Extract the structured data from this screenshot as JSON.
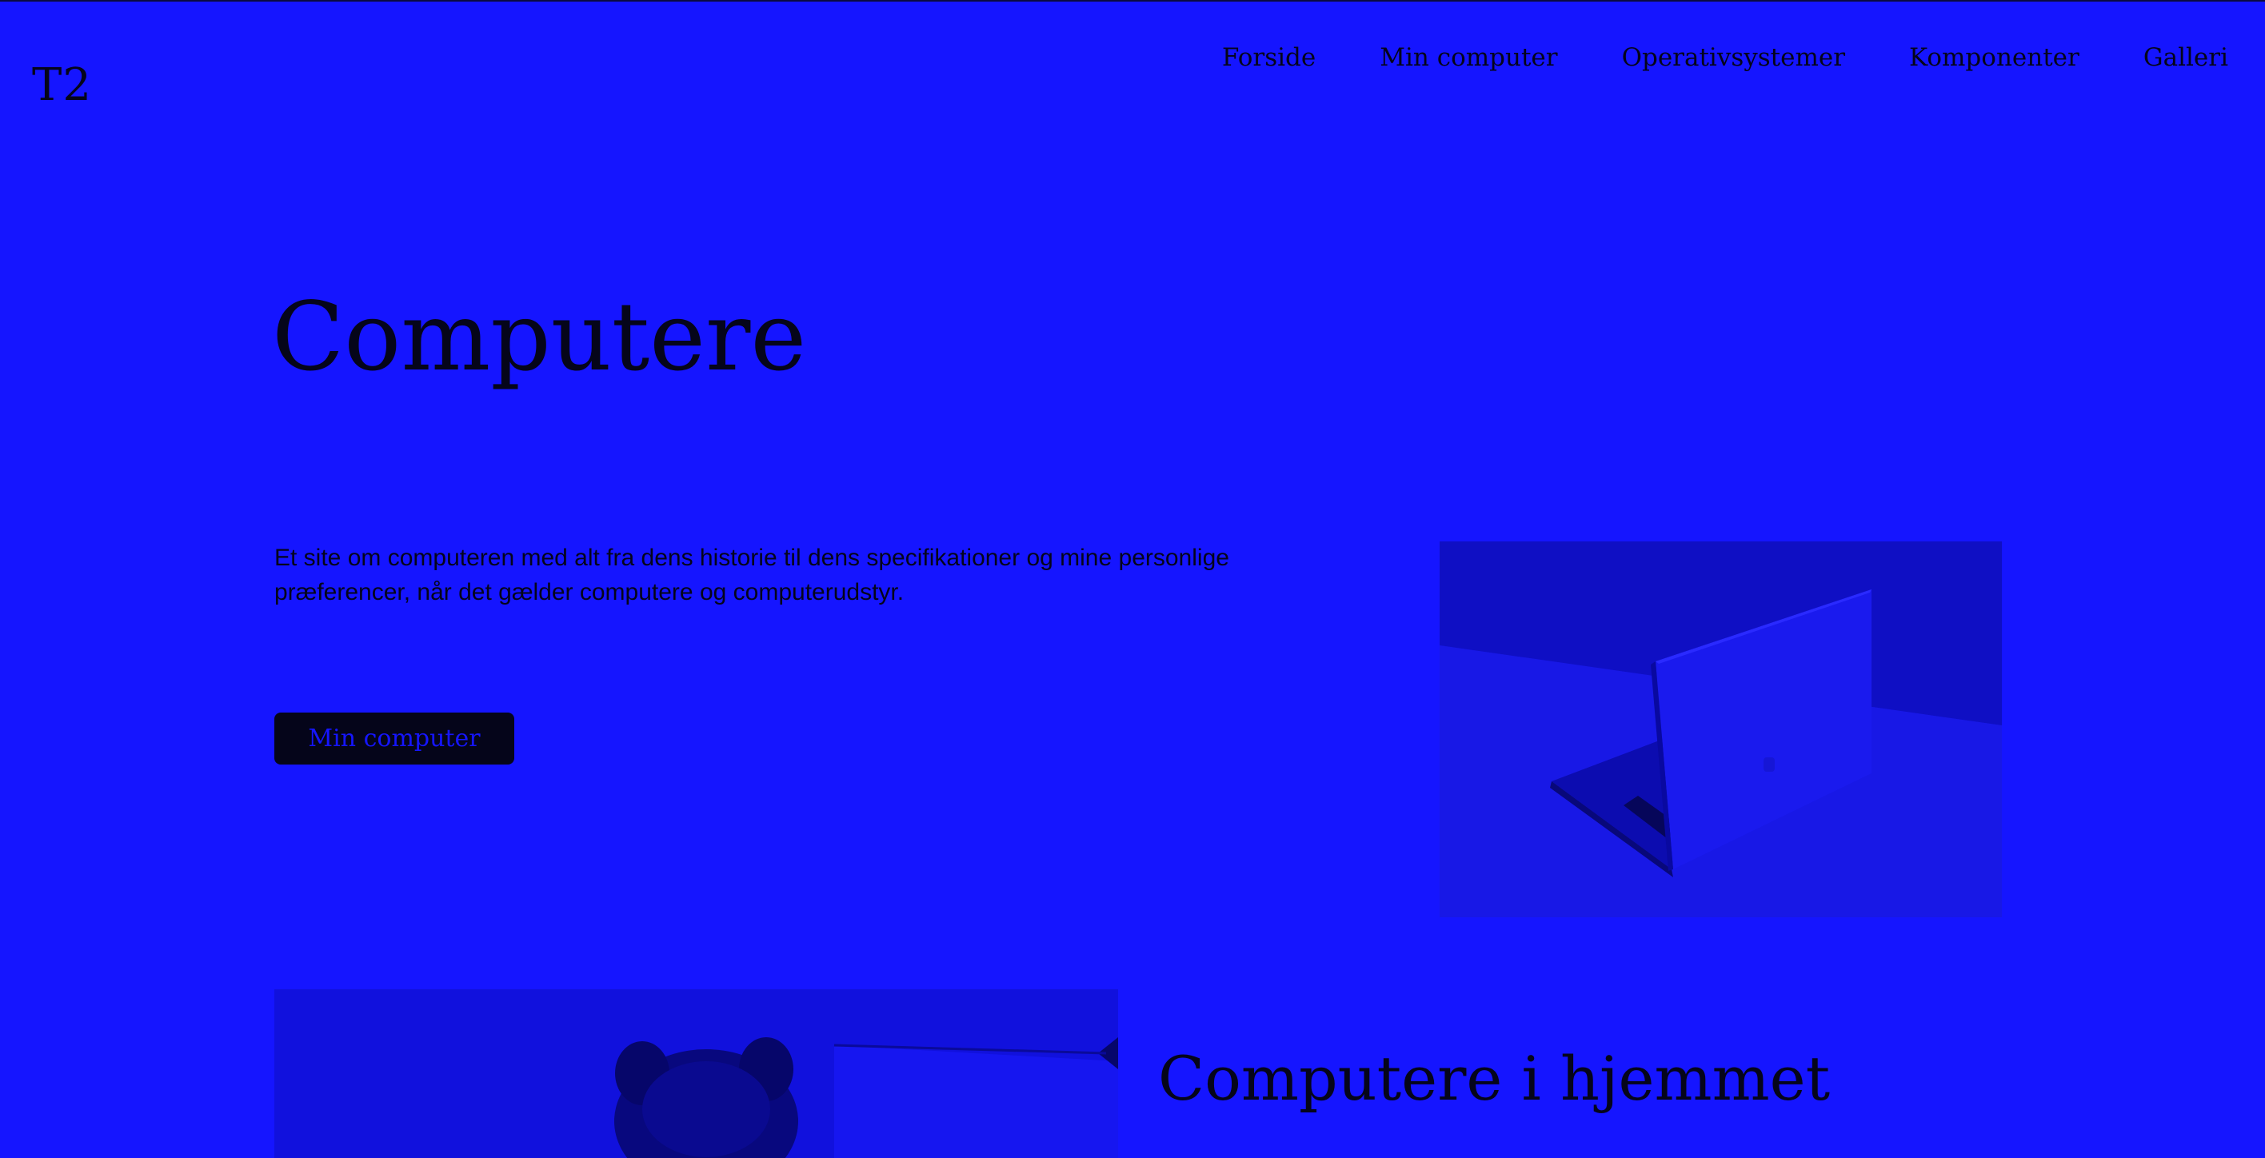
{
  "header": {
    "logo": "T2",
    "nav": [
      {
        "label": "Forside"
      },
      {
        "label": "Min computer"
      },
      {
        "label": "Operativsystemer"
      },
      {
        "label": "Komponenter"
      },
      {
        "label": "Galleri"
      }
    ]
  },
  "hero": {
    "title": "Computere",
    "intro": "Et site om computeren med alt fra dens historie til dens specifikationer og mine personlige præferencer, når det gælder computere og computerudstyr.",
    "cta_label": "Min computer"
  },
  "section": {
    "title": "Computere i hjemmet"
  },
  "colors": {
    "background": "#1515ff",
    "text": "#05051a",
    "button_bg": "#05051a",
    "button_text": "#1515ff"
  }
}
